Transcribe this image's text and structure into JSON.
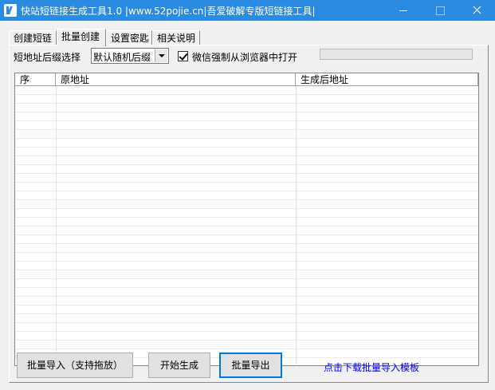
{
  "window": {
    "title": "快站短链接生成工具1.0 |www.52pojie.cn|吾爱破解专版短链接工具|"
  },
  "tabs": [
    {
      "label": "创建短链"
    },
    {
      "label": "批量创建"
    },
    {
      "label": "设置密匙"
    },
    {
      "label": "相关说明"
    }
  ],
  "active_tab": "批量创建",
  "batch": {
    "suffix_label": "短地址后缀选择",
    "suffix_value": "默认随机后缀",
    "wechat_label": "微信强制从浏览器中打开",
    "wechat_checked": true,
    "progress": 0
  },
  "table": {
    "columns": [
      "序",
      "原地址",
      "生成后地址"
    ],
    "rows": []
  },
  "buttons": {
    "import": "批量导入（支持拖放）",
    "start": "开始生成",
    "export": "批量导出"
  },
  "download_link": "点击下载批量导入模板",
  "colors": {
    "titlebar": "#2b8be0",
    "link": "#0000ff",
    "focus_border": "#0078d7"
  }
}
